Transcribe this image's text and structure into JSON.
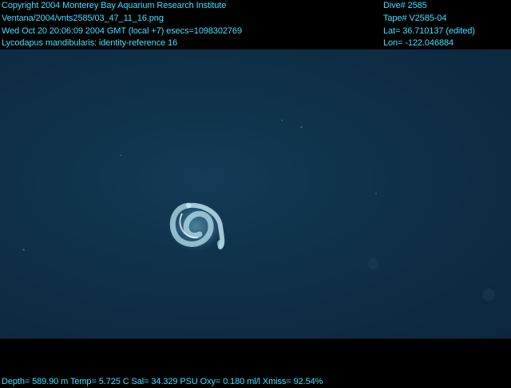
{
  "overlay": {
    "copyright": "Copyright 2004 Monterey Bay Aquarium Research Institute",
    "file": "Ventana/2004/vnts2585/03_47_11_16.png",
    "datetime": "Wed Oct 20 20:06:09 2004 GMT (local +7)  esecs=1098302769",
    "species": "Lycodapus mandibularis: identity-reference 16",
    "dive": "Dive# 2585",
    "tape": "Tape# V2585-04",
    "lat": "Lat= 36.710137 (edited)",
    "lon": "Lon= -122.046884",
    "sensors": "Depth= 589.90 m  Temp= 5.725 C  Sal= 34.329 PSU  Oxy= 0.180 ml/l  Xmiss= 92.54%"
  },
  "colors": {
    "overlay_text": "#3fe0ff",
    "water": "#0f3049"
  }
}
